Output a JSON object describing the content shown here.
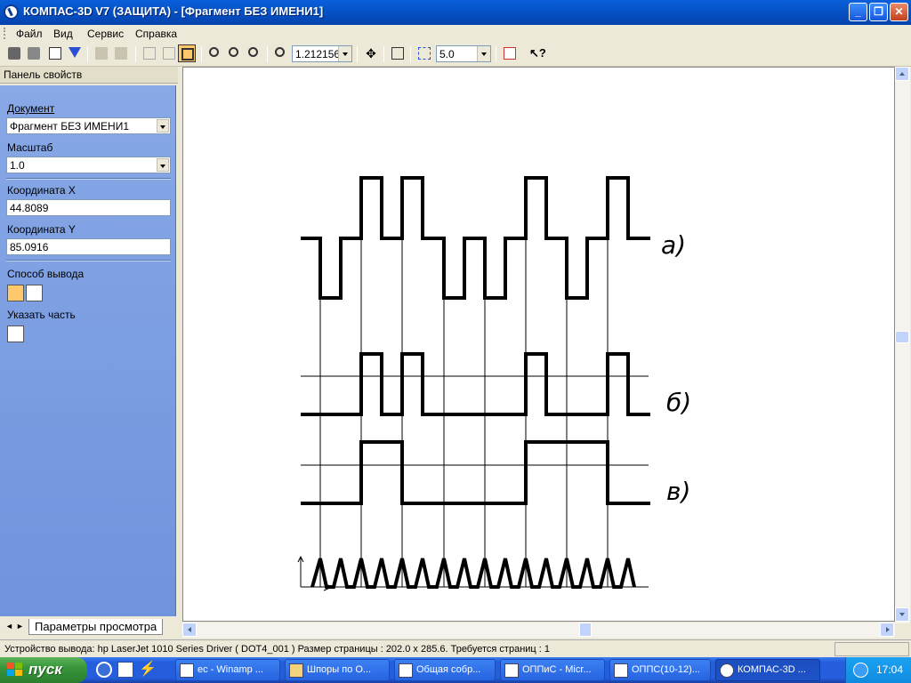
{
  "window": {
    "title": "КОМПАС-3D V7 (ЗАЩИТА) - [Фрагмент БЕЗ ИМЕНИ1]"
  },
  "window_buttons": {
    "minimize": "_",
    "restore": "❐",
    "close": "✕"
  },
  "menu": {
    "file": "Файл",
    "view": "Вид",
    "service": "Сервис",
    "help": "Справка"
  },
  "toolbar": {
    "zoom_value": "1.212156",
    "step_value": "5.0"
  },
  "panel": {
    "header": "Панель свойств",
    "document_label": "Документ",
    "document_value": "Фрагмент БЕЗ ИМЕНИ1",
    "scale_label": "Масштаб",
    "scale_value": "1.0",
    "coord_x_label": "Координата X",
    "coord_x_value": "44.8089",
    "coord_y_label": "Координата Y",
    "coord_y_value": "85.0916",
    "output_mode_label": "Способ вывода",
    "specify_part_label": "Указать часть",
    "tab_label": "Параметры просмотра",
    "nav_prev": "◄",
    "nav_next": "►"
  },
  "drawing": {
    "label_a": "а)",
    "label_b": "б)",
    "label_c": "в)"
  },
  "status": {
    "text": "Устройство вывода: hp LaserJet 1010 Series Driver ( DOT4_001 )  Размер страницы : 202.0 x 285.6.  Требуется страниц : 1"
  },
  "taskbar": {
    "start": "пуск",
    "tasks": [
      "ес - Winamp ...",
      "Шпоры по О...",
      "Общая собр...",
      "ОППиС - Micr...",
      "ОППС(10-12)...",
      "КОМПАС-3D ..."
    ],
    "time": "17:04"
  },
  "colors": {
    "accent": "#0A5FDB",
    "panel": "#7B9DE0",
    "taskbar": "#245EDC",
    "start": "#38963A"
  }
}
